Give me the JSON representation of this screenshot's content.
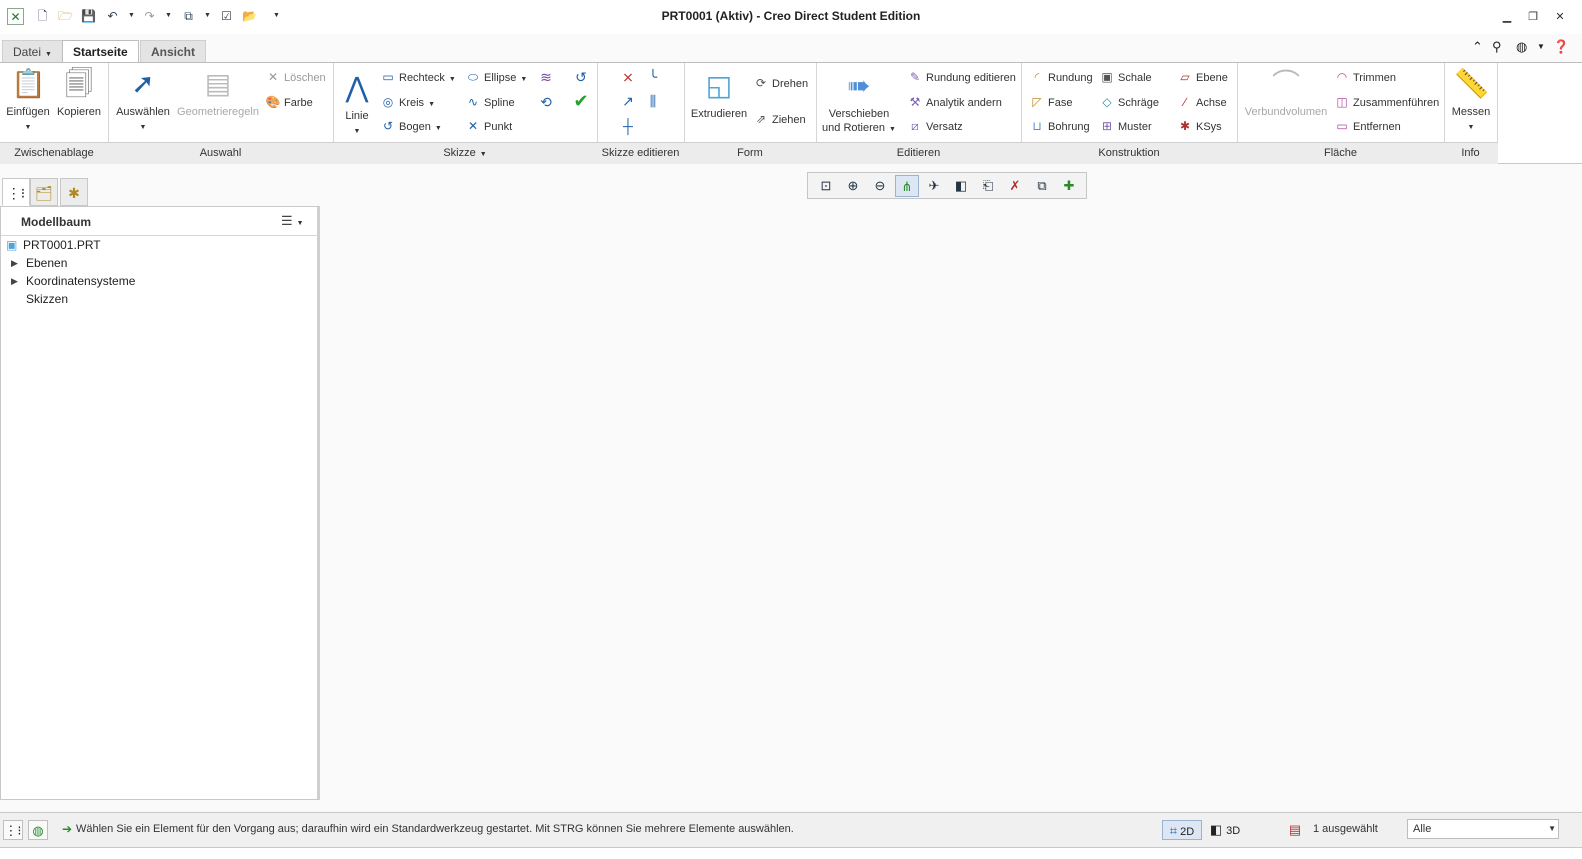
{
  "window": {
    "title": "PRT0001 (Aktiv) - Creo Direct Student Edition"
  },
  "tabs": [
    {
      "label": "Datei",
      "dropdown": true
    },
    {
      "label": "Startseite",
      "active": true
    },
    {
      "label": "Ansicht"
    }
  ],
  "ribbon": {
    "groups": {
      "clipboard": "Zwischenablage",
      "selection": "Auswahl",
      "sketch": "Skizze",
      "sketch_edit": "Skizze editieren",
      "form": "Form",
      "edit": "Editieren",
      "construction": "Konstruktion",
      "surface": "Fläche",
      "info": "Info"
    },
    "clipboard": {
      "paste": "Einfügen",
      "copy": "Kopieren"
    },
    "selection": {
      "select": "Auswählen",
      "geometry_rules": "Geometrieregeln",
      "delete": "Löschen",
      "color": "Farbe"
    },
    "sketch": {
      "line": "Linie",
      "rectangle": "Rechteck",
      "circle": "Kreis",
      "arc": "Bogen",
      "ellipse": "Ellipse",
      "spline": "Spline",
      "point": "Punkt"
    },
    "form": {
      "extrude": "Extrudieren",
      "revolve": "Drehen",
      "pull": "Ziehen"
    },
    "edit": {
      "move_rotate_1": "Verschieben",
      "move_rotate_2": "und Rotieren",
      "round_edit": "Rundung editieren",
      "analytic_change": "Analytik andern",
      "offset": "Versatz"
    },
    "construction": {
      "round": "Rundung",
      "chamfer": "Fase",
      "hole": "Bohrung",
      "shell": "Schale",
      "draft": "Schräge",
      "pattern": "Muster",
      "plane": "Ebene",
      "axis": "Achse",
      "csys": "KSys"
    },
    "surface": {
      "compound_volume": "Verbundvolumen",
      "trim": "Trimmen",
      "merge": "Zusammenführen",
      "remove": "Entfernen"
    },
    "info": {
      "measure": "Messen"
    }
  },
  "model_tree": {
    "title": "Modellbaum",
    "root": "PRT0001.PRT",
    "items": [
      {
        "label": "Ebenen",
        "expandable": true
      },
      {
        "label": "Koordinatensysteme",
        "expandable": true
      },
      {
        "label": "Skizzen",
        "expandable": false
      }
    ]
  },
  "statusbar": {
    "message": "Wählen Sie ein Element für den Vorgang aus; daraufhin wird ein Standardwerkzeug gestartet. Mit STRG können Sie mehrere Elemente auswählen.",
    "mode_2d": "2D",
    "mode_3d": "3D",
    "selected_count": "1 ausgewählt",
    "filter": "Alle"
  },
  "colors": {
    "accent": "#1f5fa8",
    "ribbon_bg": "#ffffff",
    "group_bar": "#ececec"
  }
}
